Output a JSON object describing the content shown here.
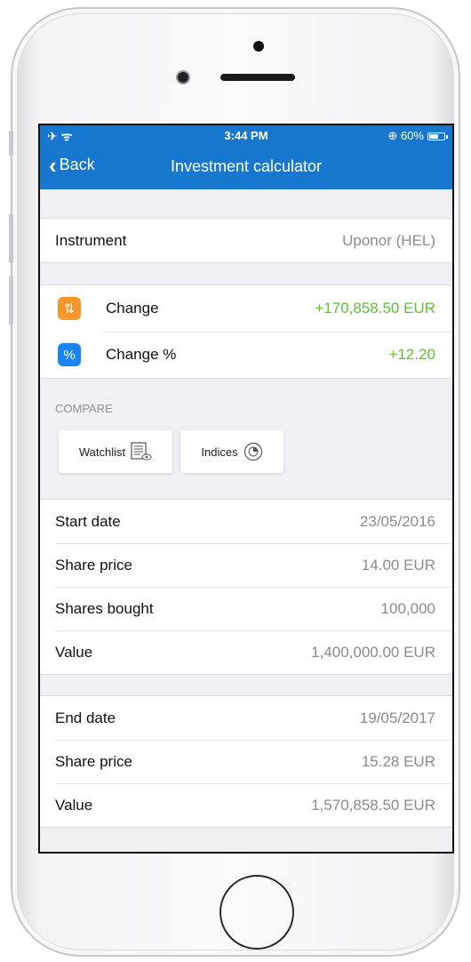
{
  "status_bar": {
    "time": "3:44 PM",
    "battery": "60%",
    "battery_level": 0.6
  },
  "nav": {
    "back_label": "Back",
    "title": "Investment calculator"
  },
  "instrument": {
    "label": "Instrument",
    "value": "Uponor (HEL)"
  },
  "changes": [
    {
      "label": "Change",
      "value": "+170,858.50 EUR",
      "icon": "swap-arrows-icon",
      "color": "#f7962a"
    },
    {
      "label": "Change %",
      "value": "+12.20",
      "icon": "percent-icon",
      "color": "#1a82f2"
    }
  ],
  "compare": {
    "heading": "COMPARE",
    "watchlist_label": "Watchlist",
    "indices_label": "Indices"
  },
  "start": [
    {
      "label": "Start date",
      "value": "23/05/2016"
    },
    {
      "label": "Share price",
      "value": "14.00 EUR"
    },
    {
      "label": "Shares bought",
      "value": "100,000"
    },
    {
      "label": "Value",
      "value": "1,400,000.00 EUR"
    }
  ],
  "end": [
    {
      "label": "End date",
      "value": "19/05/2017"
    },
    {
      "label": "Share price",
      "value": "15.28 EUR"
    },
    {
      "label": "Value",
      "value": "1,570,858.50 EUR"
    }
  ],
  "colors": {
    "accent": "#1777cf",
    "positive": "#5ec22f"
  }
}
